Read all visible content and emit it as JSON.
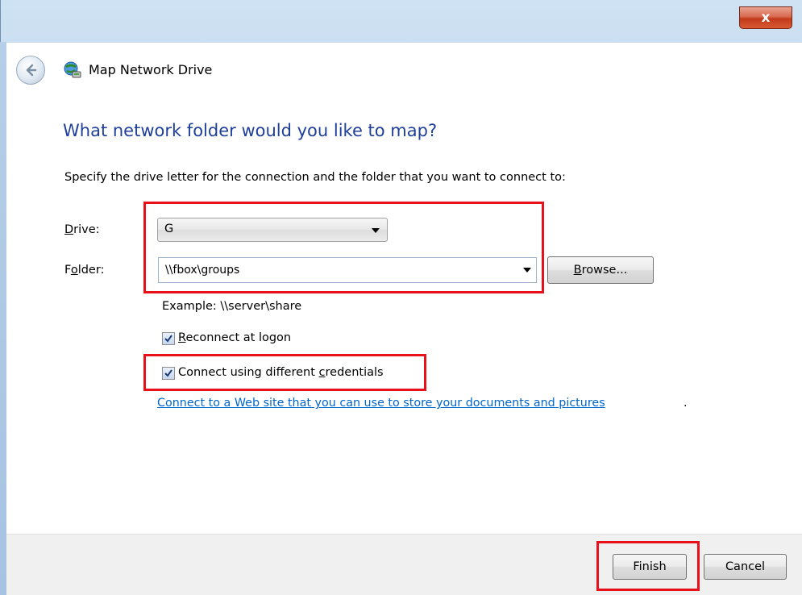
{
  "window": {
    "close_glyph": "x",
    "title": "Map Network Drive"
  },
  "heading": "What network folder would you like to map?",
  "instructions": "Specify the drive letter for the connection and the folder that you want to connect to:",
  "drive": {
    "label_underlined": "D",
    "label_rest": "rive:",
    "value": "G"
  },
  "folder": {
    "label_start": "F",
    "label_underlined": "o",
    "label_rest": "lder:",
    "value": "\\\\fbox\\groups"
  },
  "browse": {
    "underlined": "B",
    "rest": "rowse..."
  },
  "example": "Example: \\\\server\\share",
  "reconnect": {
    "underlined": "R",
    "rest": "econnect at logon",
    "checked": true
  },
  "credentials": {
    "start": "Connect using different ",
    "underlined": "c",
    "rest": "redentials",
    "checked": true
  },
  "link": {
    "text": "Connect to a Web site that you can use to store your documents and pictures",
    "trailing": "."
  },
  "buttons": {
    "finish": "Finish",
    "cancel": "Cancel"
  },
  "colors": {
    "heading": "#1f3f9b",
    "link": "#0066cc",
    "highlight": "#e8101a"
  }
}
